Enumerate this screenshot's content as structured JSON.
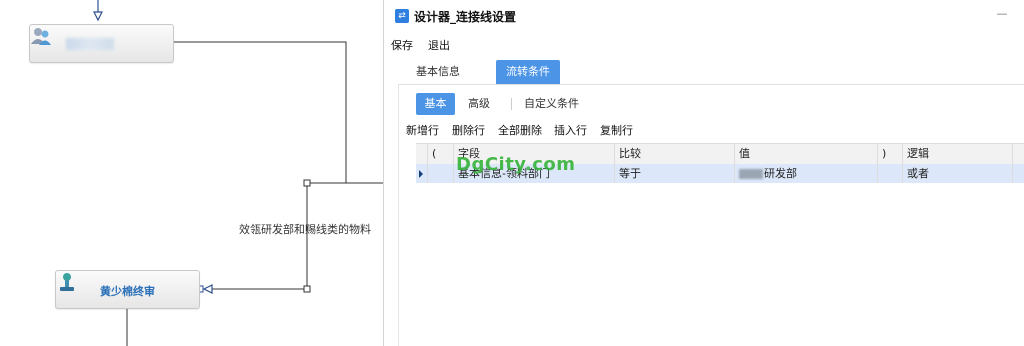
{
  "canvas": {
    "top_node_label": "",
    "bottom_node_label": "黄少棉终审",
    "line_label": "效瓴研发部和赐线类的物料"
  },
  "dialog": {
    "title": "设计器_连接线设置",
    "minimize_symbol": "—",
    "menu": {
      "save": "保存",
      "exit": "退出"
    },
    "tabs": [
      "基本信息",
      "流转条件"
    ],
    "active_tab": "流转条件",
    "subtabs": [
      "基本",
      "高级",
      "自定义条件"
    ],
    "active_subtab": "基本",
    "toolbar": [
      "新增行",
      "删除行",
      "全部删除",
      "插入行",
      "复制行"
    ],
    "grid": {
      "columns": [
        "(",
        "字段",
        "比较",
        "值",
        ")",
        "逻辑"
      ],
      "rows": [
        {
          "open": "",
          "field": "基本信息-领料部门",
          "compare": "等于",
          "value": "研发部",
          "close": "",
          "logic": "或者"
        }
      ]
    }
  },
  "watermark": "DgCity.com",
  "colors": {
    "accent": "#4c95e6",
    "selected_row": "#dce8fa",
    "node_label": "#2a6fb8",
    "watermark": "#35b33a"
  }
}
